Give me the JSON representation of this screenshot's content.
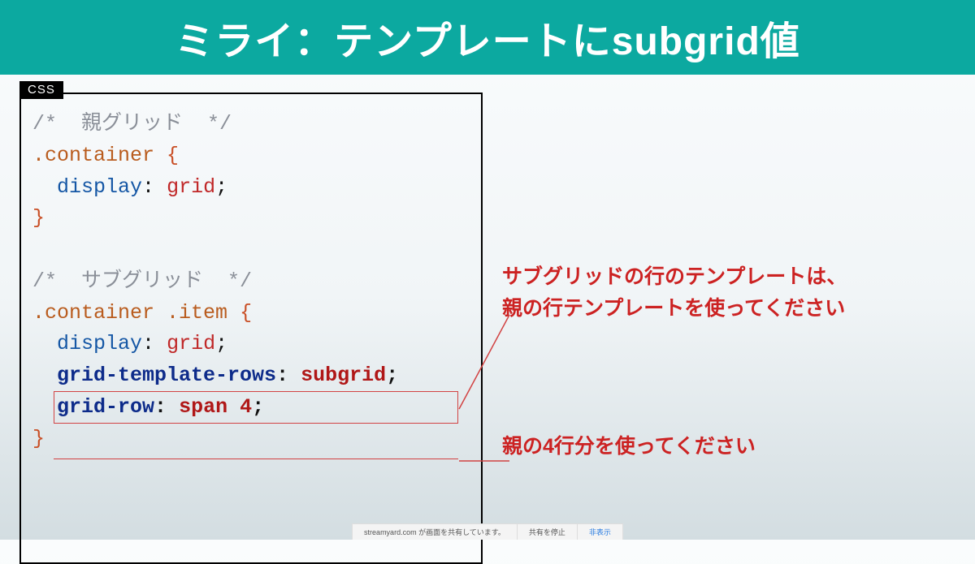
{
  "title": "ミライ：テンプレートにsubgrid値",
  "code_tab": "CSS",
  "code": {
    "comment_parent": "/*  親グリッド  */",
    "sel_container": ".container",
    "brace_open": "{",
    "brace_close": "}",
    "prop_display": "display",
    "val_grid": "grid",
    "semicolon": ";",
    "colon": ":",
    "comment_sub": "/*  サブグリッド  */",
    "sel_sub": ".container .item",
    "prop_gtr": "grid-template-rows",
    "val_subgrid": "subgrid",
    "prop_gridrow": "grid-row",
    "val_span4": "span 4"
  },
  "annotations": {
    "line1a": "サブグリッドの行のテンプレートは、",
    "line1b": "親の行テンプレートを使ってください",
    "line2": "親の4行分を使ってください"
  },
  "bottom_bar": {
    "share_msg": "streamyard.com が画面を共有しています。",
    "stop": "共有を停止",
    "hide": "非表示"
  }
}
